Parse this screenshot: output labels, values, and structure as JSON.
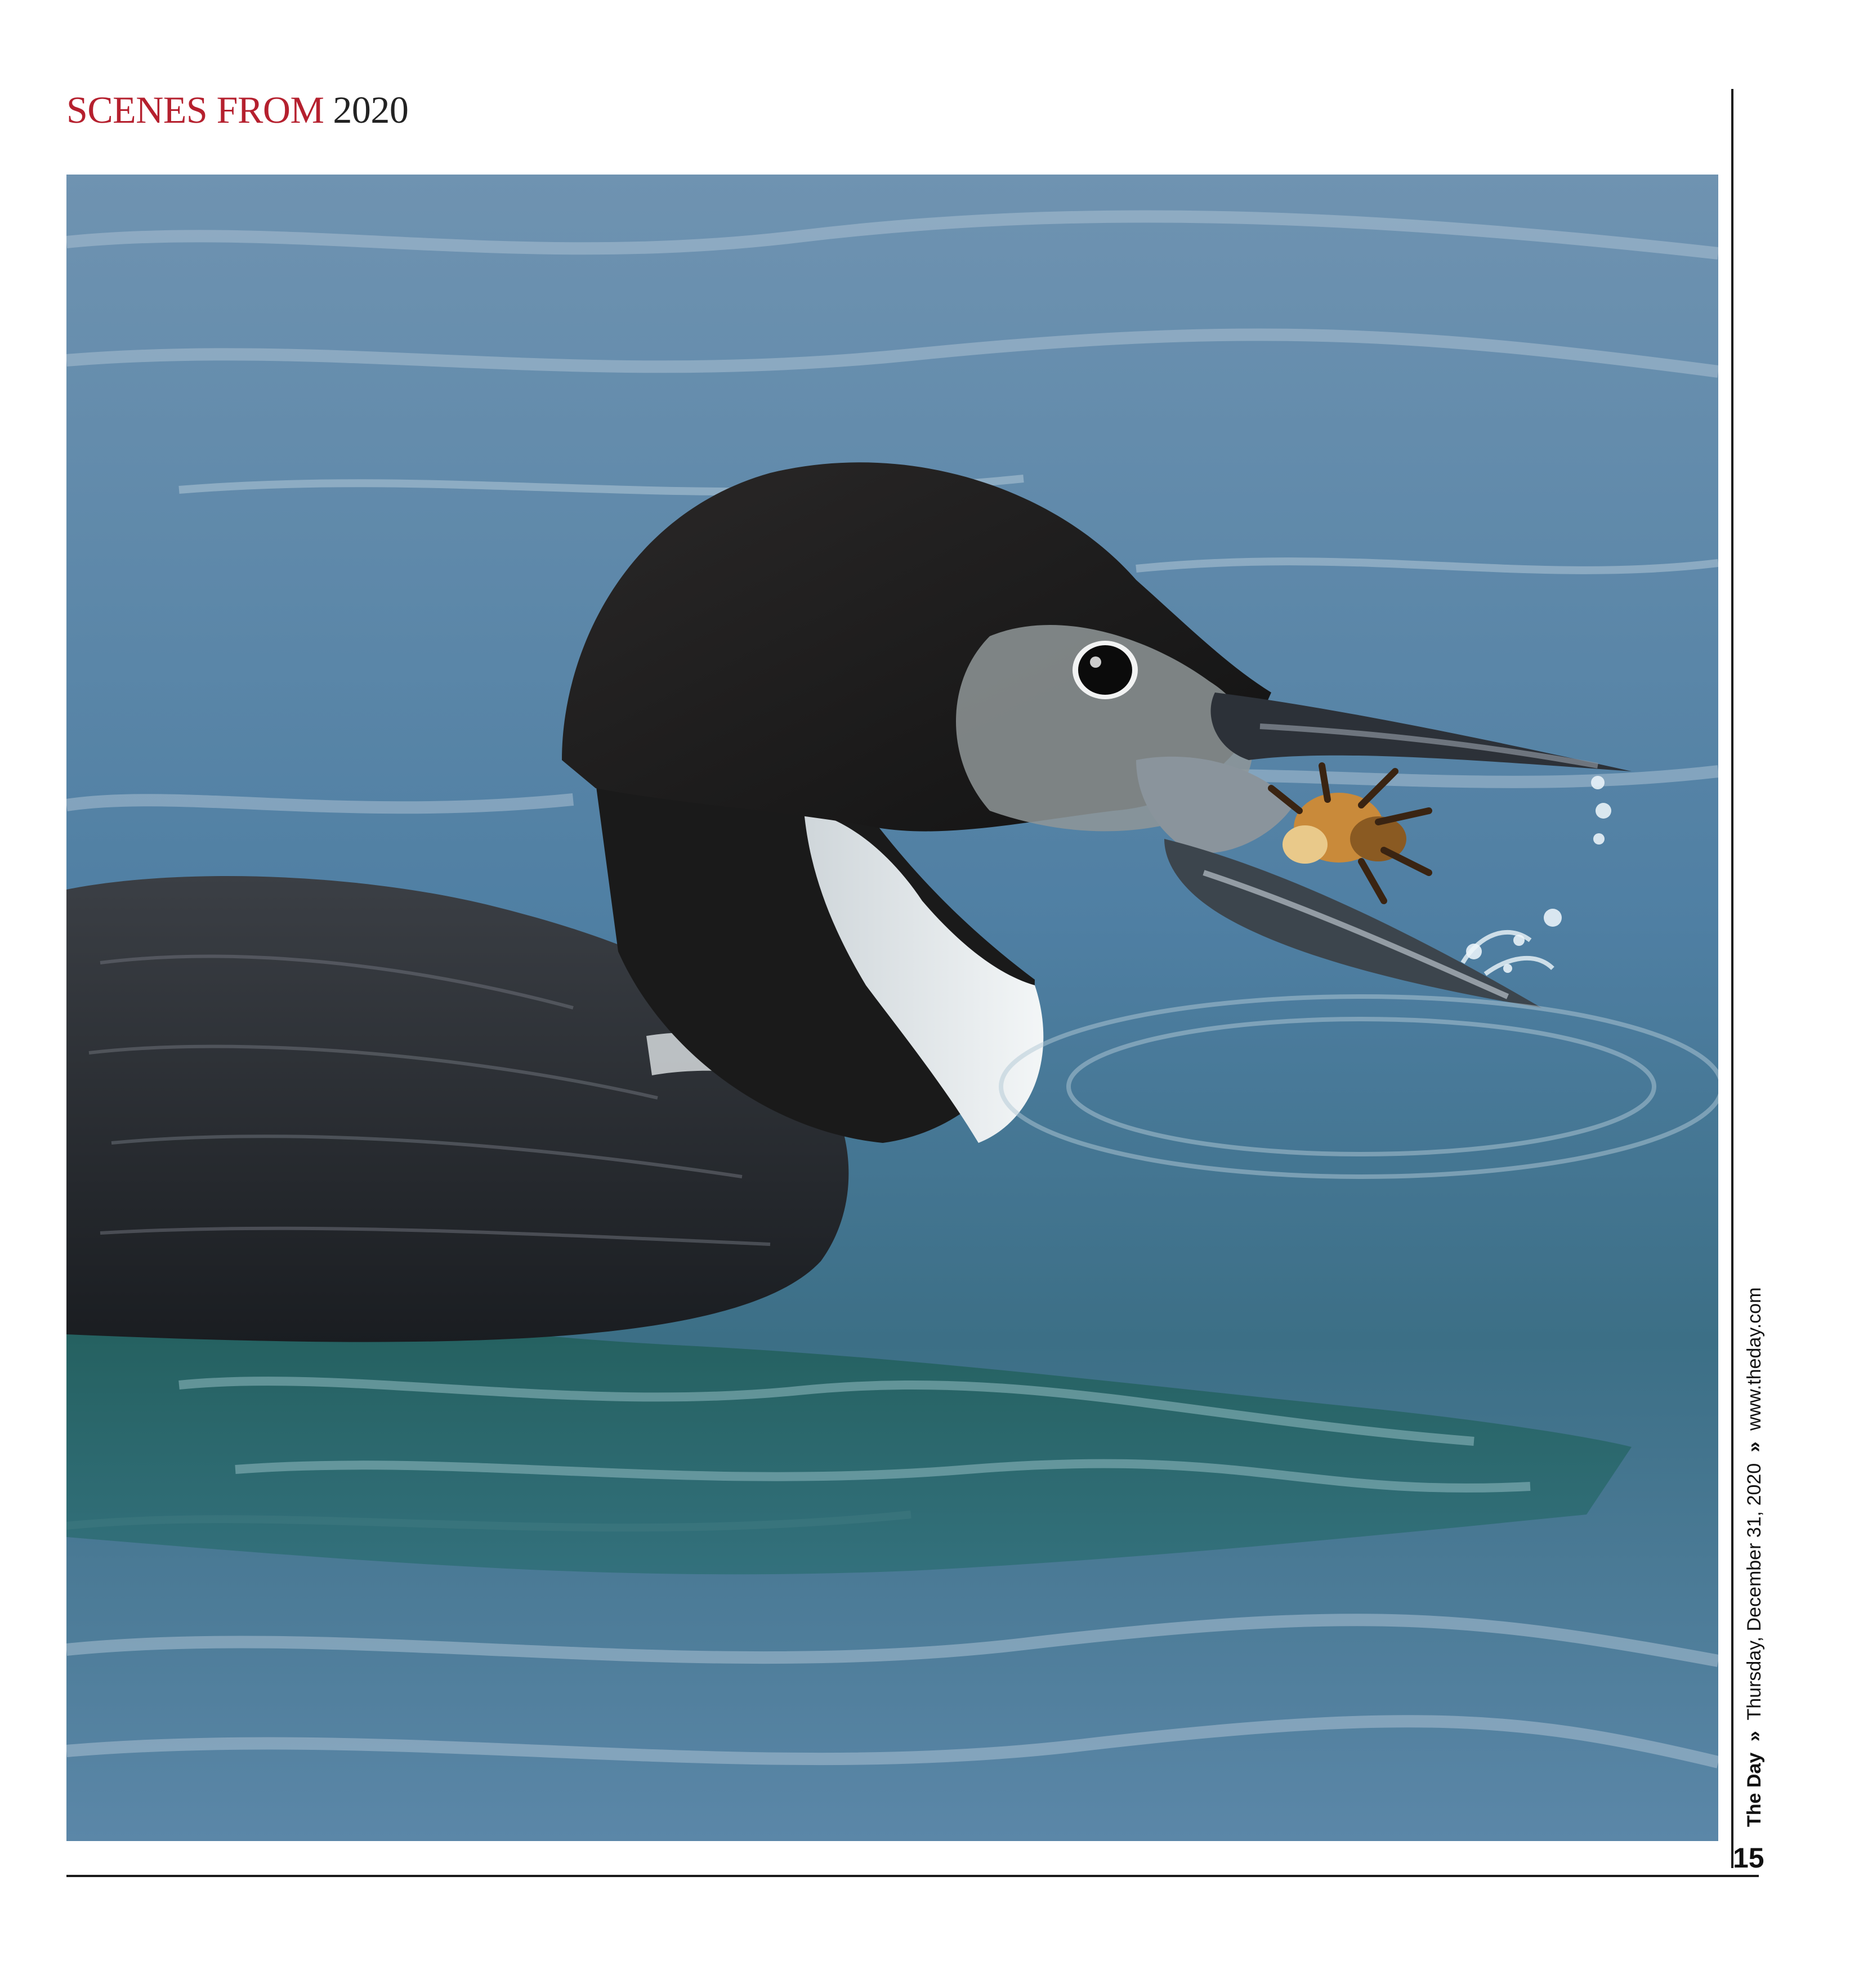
{
  "header": {
    "kicker": "SCENES FROM",
    "year": "2020"
  },
  "folio": {
    "paper": "The Day",
    "separator": "»",
    "date": "Thursday, December 31, 2020",
    "url": "www.theday.com"
  },
  "page_number": "15",
  "colors": {
    "kicker": "#b5202e",
    "water": "#5d87a6",
    "loon_head": "#1e1c1c"
  }
}
